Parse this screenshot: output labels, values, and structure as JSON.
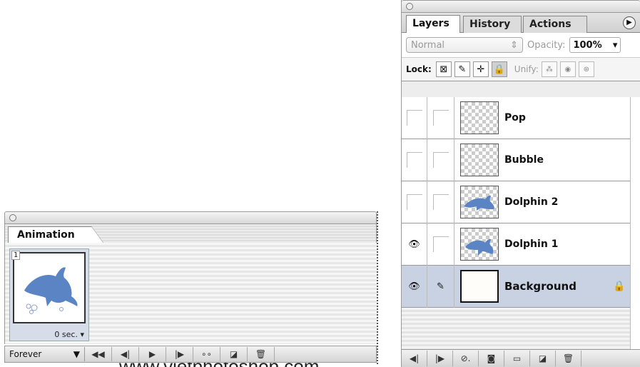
{
  "animation_panel": {
    "tab_label": "Animation",
    "frame": {
      "number": "1",
      "delay": "0 sec."
    },
    "loop_option": "Forever",
    "watermark": "www.vietphotoshop.com",
    "toolbar_icons": [
      "first-frame-icon",
      "previous-frame-icon",
      "play-icon",
      "next-frame-icon",
      "tween-icon",
      "duplicate-frame-icon",
      "trash-icon"
    ]
  },
  "layers_panel": {
    "tabs": [
      {
        "label": "Layers",
        "active": true
      },
      {
        "label": "History",
        "active": false
      },
      {
        "label": "Actions",
        "active": false
      }
    ],
    "blend_mode": "Normal",
    "opacity_label": "Opacity:",
    "opacity_value": "100%",
    "lock_label": "Lock:",
    "unify_label": "Unify:",
    "layers": [
      {
        "name": "Pop",
        "visible": false,
        "selected": false,
        "thumbnail": "transparent"
      },
      {
        "name": "Bubble",
        "visible": false,
        "selected": false,
        "thumbnail": "transparent"
      },
      {
        "name": "Dolphin 2",
        "visible": false,
        "selected": false,
        "thumbnail": "dolphin"
      },
      {
        "name": "Dolphin 1",
        "visible": true,
        "selected": false,
        "thumbnail": "dolphin"
      },
      {
        "name": "Background",
        "visible": true,
        "selected": true,
        "locked": true,
        "thumbnail": "white"
      }
    ],
    "toolbar_icons": [
      "prev-frame-icon",
      "next-frame-icon",
      "layer-style-icon",
      "layer-mask-icon",
      "new-group-icon",
      "new-layer-icon",
      "trash-icon"
    ]
  },
  "colors": {
    "selected_row": "#c9d2e2",
    "dolphin": "#5b84c4"
  }
}
